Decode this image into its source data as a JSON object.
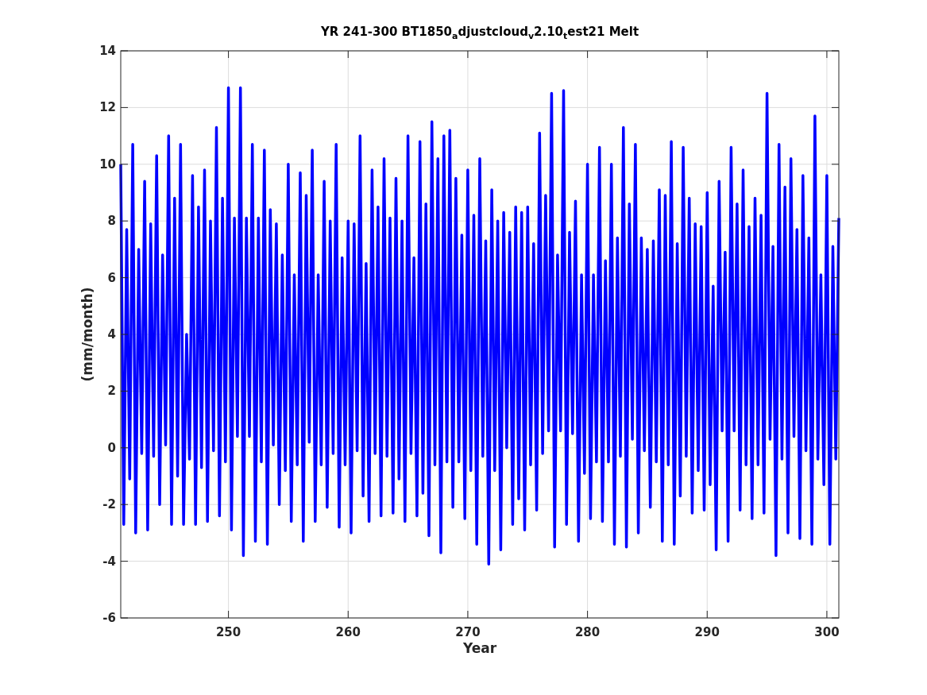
{
  "figure": {
    "chart_data": {
      "type": "line",
      "title": "YR 241-300 BT1850$_{a}$djustcloud$_{v}$2.10$_{t}$est21 Melt",
      "xlabel": "Year",
      "ylabel": "(mm/month)",
      "xlim": [
        241,
        301
      ],
      "ylim": [
        -6,
        14
      ],
      "xticks": [
        250,
        260,
        270,
        280,
        290,
        300
      ],
      "yticks": [
        -6,
        -4,
        -2,
        0,
        2,
        4,
        6,
        8,
        10,
        12,
        14
      ],
      "x": [
        241,
        241.25,
        241.5,
        241.75,
        242,
        242.25,
        242.5,
        242.75,
        243,
        243.25,
        243.5,
        243.75,
        244,
        244.25,
        244.5,
        244.75,
        245,
        245.25,
        245.5,
        245.75,
        246,
        246.25,
        246.5,
        246.75,
        247,
        247.25,
        247.5,
        247.75,
        248,
        248.25,
        248.5,
        248.75,
        249,
        249.25,
        249.5,
        249.75,
        250,
        250.25,
        250.5,
        250.75,
        251,
        251.25,
        251.5,
        251.75,
        252,
        252.25,
        252.5,
        252.75,
        253,
        253.25,
        253.5,
        253.75,
        254,
        254.25,
        254.5,
        254.75,
        255,
        255.25,
        255.5,
        255.75,
        256,
        256.25,
        256.5,
        256.75,
        257,
        257.25,
        257.5,
        257.75,
        258,
        258.25,
        258.5,
        258.75,
        259,
        259.25,
        259.5,
        259.75,
        260,
        260.25,
        260.5,
        260.75,
        261,
        261.25,
        261.5,
        261.75,
        262,
        262.25,
        262.5,
        262.75,
        263,
        263.25,
        263.5,
        263.75,
        264,
        264.25,
        264.5,
        264.75,
        265,
        265.25,
        265.5,
        265.75,
        266,
        266.25,
        266.5,
        266.75,
        267,
        267.25,
        267.5,
        267.75,
        268,
        268.25,
        268.5,
        268.75,
        269,
        269.25,
        269.5,
        269.75,
        270,
        270.25,
        270.5,
        270.75,
        271,
        271.25,
        271.5,
        271.75,
        272,
        272.25,
        272.5,
        272.75,
        273,
        273.25,
        273.5,
        273.75,
        274,
        274.25,
        274.5,
        274.75,
        275,
        275.25,
        275.5,
        275.75,
        276,
        276.25,
        276.5,
        276.75,
        277,
        277.25,
        277.5,
        277.75,
        278,
        278.25,
        278.5,
        278.75,
        279,
        279.25,
        279.5,
        279.75,
        280,
        280.25,
        280.5,
        280.75,
        281,
        281.25,
        281.5,
        281.75,
        282,
        282.25,
        282.5,
        282.75,
        283,
        283.25,
        283.5,
        283.75,
        284,
        284.25,
        284.5,
        284.75,
        285,
        285.25,
        285.5,
        285.75,
        286,
        286.25,
        286.5,
        286.75,
        287,
        287.25,
        287.5,
        287.75,
        288,
        288.25,
        288.5,
        288.75,
        289,
        289.25,
        289.5,
        289.75,
        290,
        290.25,
        290.5,
        290.75,
        291,
        291.25,
        291.5,
        291.75,
        292,
        292.25,
        292.5,
        292.75,
        293,
        293.25,
        293.5,
        293.75,
        294,
        294.25,
        294.5,
        294.75,
        295,
        295.25,
        295.5,
        295.75,
        296,
        296.25,
        296.5,
        296.75,
        297,
        297.25,
        297.5,
        297.75,
        298,
        298.25,
        298.5,
        298.75,
        299,
        299.25,
        299.5,
        299.75,
        300,
        300.25,
        300.5,
        300.75,
        301
      ],
      "grid": true,
      "series": [
        {
          "color": "#0000ff",
          "values": [
            10,
            -2.7,
            7.7,
            -1.1,
            10.7,
            -3,
            7,
            -0.2,
            9.4,
            -2.9,
            7.9,
            -0.3,
            10.3,
            -2,
            6.8,
            0.1,
            11,
            -2.7,
            8.8,
            -1,
            10.7,
            -2.7,
            4,
            -0.4,
            9.6,
            -2.7,
            8.5,
            -0.7,
            9.8,
            -2.6,
            8,
            -0.1,
            11.3,
            -2.4,
            8.8,
            -0.5,
            12.7,
            -2.9,
            8.1,
            0.4,
            12.7,
            -3.8,
            8.1,
            0.4,
            10.7,
            -3.3,
            8.1,
            -0.5,
            10.5,
            -3.4,
            8.4,
            0.1,
            7.9,
            -2,
            6.8,
            -0.8,
            10,
            -2.6,
            6.1,
            -0.6,
            9.7,
            -3.3,
            8.9,
            0.2,
            10.5,
            -2.6,
            6.1,
            -0.6,
            9.4,
            -2.1,
            8,
            -0.2,
            10.7,
            -2.8,
            6.7,
            -0.6,
            8,
            -3,
            7.9,
            -0.1,
            11,
            -1.7,
            6.5,
            -2.6,
            9.8,
            -0.2,
            8.5,
            -2.4,
            10.2,
            -0.3,
            8.1,
            -2.3,
            9.5,
            -1.1,
            8,
            -2.6,
            11,
            -0.2,
            6.7,
            -2.4,
            10.8,
            -1.6,
            8.6,
            -3.1,
            11.5,
            -0.6,
            10.2,
            -3.7,
            11,
            -0.5,
            11.2,
            -2.1,
            9.5,
            -0.5,
            7.5,
            -2.5,
            9.8,
            -0.8,
            8.2,
            -3.4,
            10.2,
            -0.3,
            7.3,
            -4.1,
            9.1,
            -0.8,
            8,
            -3.6,
            8.3,
            0,
            7.6,
            -2.7,
            8.5,
            -1.8,
            8.3,
            -2.9,
            8.5,
            -0.6,
            7.2,
            -2.2,
            11.1,
            -0.2,
            8.9,
            0.6,
            12.5,
            -3.5,
            6.8,
            0.6,
            12.6,
            -2.7,
            7.6,
            0.5,
            8.7,
            -3.3,
            6.1,
            -0.9,
            10,
            -2.5,
            6.1,
            -0.5,
            10.6,
            -2.6,
            6.6,
            -0.5,
            10,
            -3.4,
            7.4,
            -0.3,
            11.3,
            -3.5,
            8.6,
            0.3,
            10.7,
            -3,
            7.4,
            -0.1,
            7,
            -2.1,
            7.3,
            -0.5,
            9.1,
            -3.3,
            8.9,
            -0.6,
            10.8,
            -3.4,
            7.2,
            -1.7,
            10.6,
            -0.3,
            8.8,
            -2.3,
            7.9,
            -0.8,
            7.8,
            -2.2,
            9,
            -1.3,
            5.7,
            -3.6,
            9.4,
            0.6,
            6.9,
            -3.3,
            10.6,
            0.6,
            8.6,
            -2.2,
            9.8,
            -0.6,
            7.8,
            -2.5,
            8.8,
            -0.6,
            8.2,
            -2.3,
            12.5,
            0.3,
            7.1,
            -3.8,
            10.7,
            -0.4,
            9.2,
            -3,
            10.2,
            0.4,
            7.7,
            -3.2,
            9.6,
            -0.1,
            7.4,
            -3.4,
            11.7,
            -0.4,
            6.1,
            -1.3,
            9.6,
            -3.4,
            7.1,
            -0.4,
            8.1
          ]
        }
      ]
    }
  }
}
